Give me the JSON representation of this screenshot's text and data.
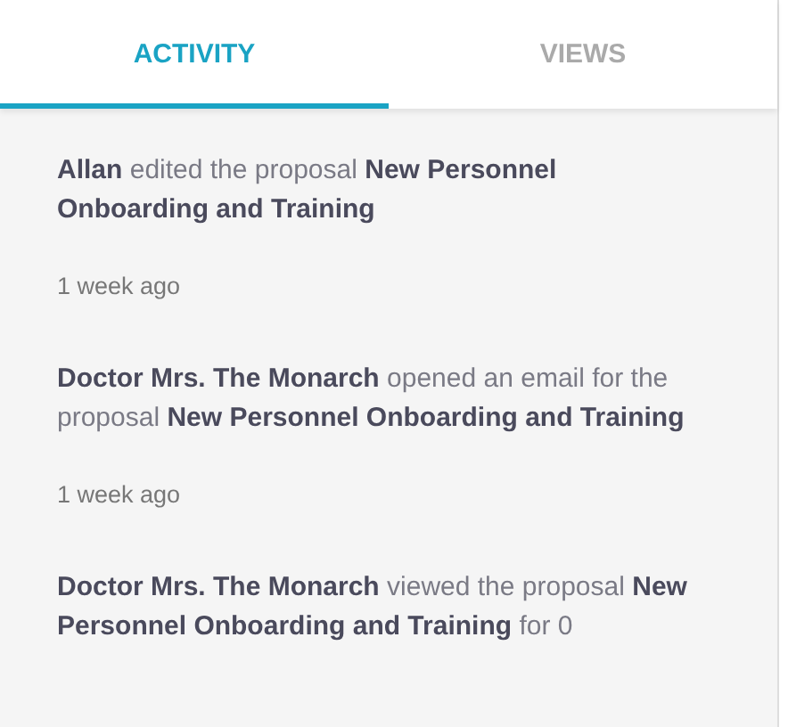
{
  "tabs": [
    {
      "label": "ACTIVITY",
      "selected": true
    },
    {
      "label": "VIEWS",
      "selected": false
    }
  ],
  "activities": [
    {
      "text": "**Allan** edited the proposal **New Personnel Onboarding and Training**",
      "time": "1 week ago"
    },
    {
      "text": "**Doctor Mrs. The Monarch** opened an email for the proposal **New Personnel Onboarding and Training**",
      "time": "1 week ago"
    },
    {
      "text": "**Doctor Mrs. The Monarch** viewed the proposal **New Personnel Onboarding and Training** for 0"
    }
  ]
}
